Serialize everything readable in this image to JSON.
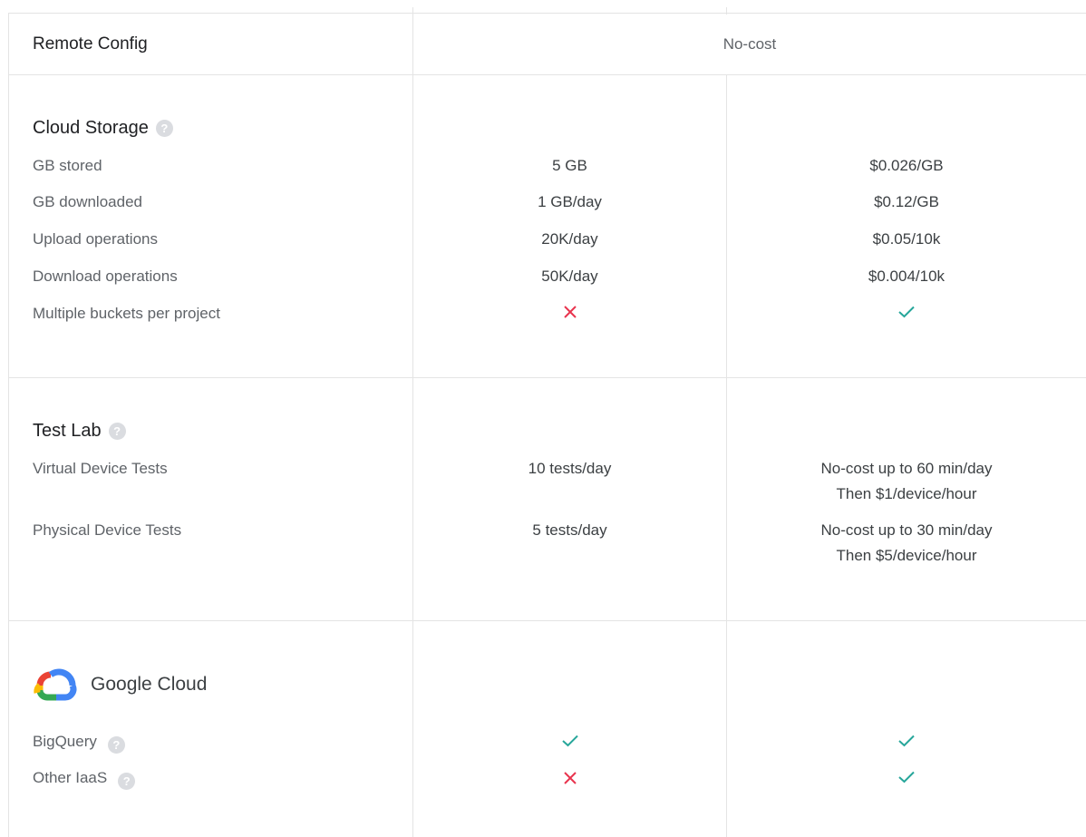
{
  "remote_config": {
    "label": "Remote Config",
    "value": "No-cost"
  },
  "cloud_storage": {
    "title": "Cloud Storage",
    "rows": [
      {
        "label": "GB stored",
        "free": "5 GB",
        "paid": "$0.026/GB"
      },
      {
        "label": "GB downloaded",
        "free": "1 GB/day",
        "paid": "$0.12/GB"
      },
      {
        "label": "Upload operations",
        "free": "20K/day",
        "paid": "$0.05/10k"
      },
      {
        "label": "Download operations",
        "free": "50K/day",
        "paid": "$0.004/10k"
      },
      {
        "label": "Multiple buckets per project",
        "free": "cross-icon",
        "paid": "check-icon"
      }
    ]
  },
  "test_lab": {
    "title": "Test Lab",
    "rows": [
      {
        "label": "Virtual Device Tests",
        "free": "10 tests/day",
        "paid_line1": "No-cost up to 60 min/day",
        "paid_line2": "Then $1/device/hour"
      },
      {
        "label": "Physical Device Tests",
        "free": "5 tests/day",
        "paid_line1": "No-cost up to 30 min/day",
        "paid_line2": "Then $5/device/hour"
      }
    ]
  },
  "google_cloud": {
    "title": "Google Cloud",
    "rows": [
      {
        "label": "BigQuery",
        "free": "check-icon",
        "paid": "check-icon"
      },
      {
        "label": "Other IaaS",
        "free": "cross-icon",
        "paid": "check-icon"
      }
    ]
  },
  "help_glyph": "?",
  "colors": {
    "check": "#26a69a",
    "cross": "#e8344e",
    "divider": "#e4e4e4"
  }
}
